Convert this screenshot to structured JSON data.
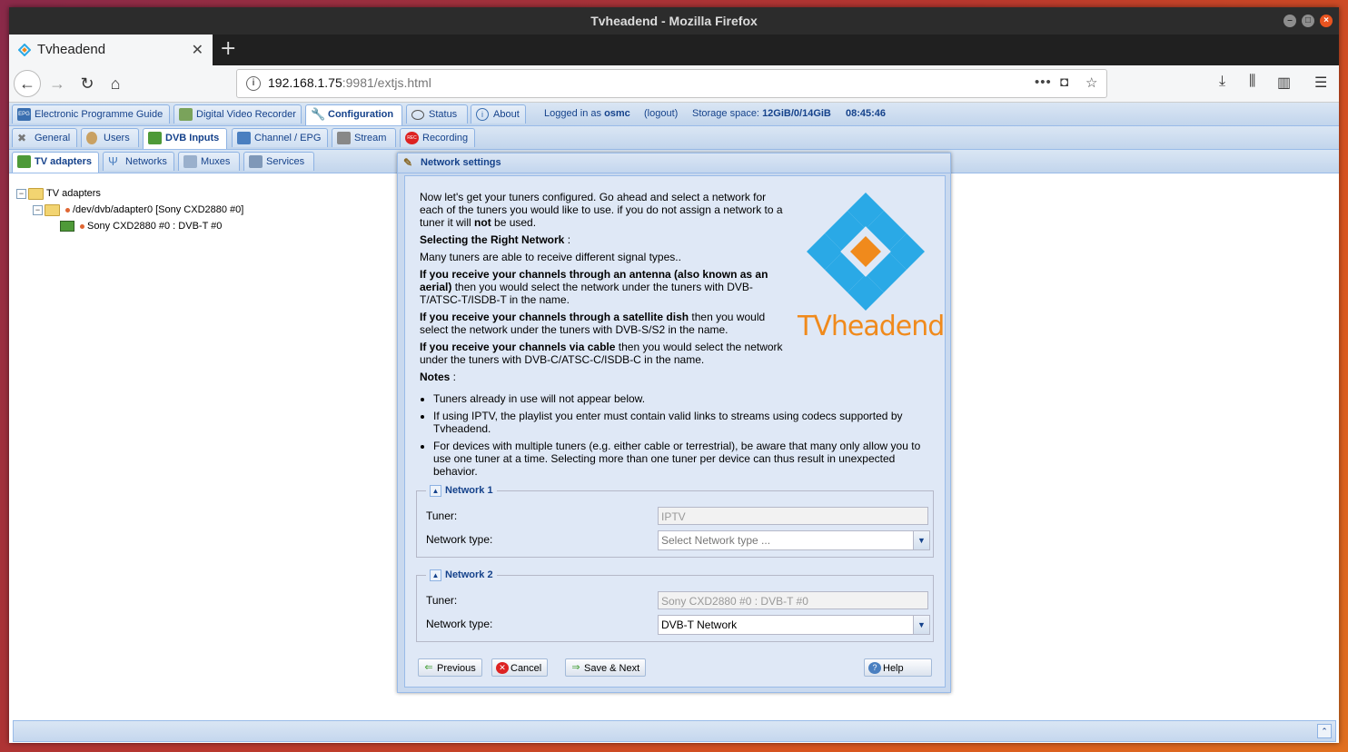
{
  "window": {
    "title": "Tvheadend - Mozilla Firefox"
  },
  "browser": {
    "tab_title": "Tvheadend",
    "url_host": "192.168.1.75",
    "url_rest": ":9981/extjs.html",
    "overflow": "•••"
  },
  "toolbar1": {
    "tabs": [
      "Electronic Programme Guide",
      "Digital Video Recorder",
      "Configuration",
      "Status",
      "About"
    ],
    "logged_in_prefix": "Logged in as",
    "user": "osmc",
    "logout": "(logout)",
    "storage_label": "Storage space:",
    "storage_value": "12GiB/0/14GiB",
    "time": "08:45:46"
  },
  "toolbar2": {
    "tabs": [
      "General",
      "Users",
      "DVB Inputs",
      "Channel / EPG",
      "Stream",
      "Recording"
    ]
  },
  "toolbar3": {
    "tabs": [
      "TV adapters",
      "Networks",
      "Muxes",
      "Services"
    ]
  },
  "tree": {
    "root": "TV adapters",
    "adapter": "/dev/dvb/adapter0 [Sony CXD2880 #0]",
    "frontend": "Sony CXD2880 #0 : DVB-T #0"
  },
  "dialog": {
    "title": "Network settings",
    "intro": "Now let's get your tuners configured. Go ahead and select a network for each of the tuners you would like to use. if you do not assign a network to a tuner it will",
    "intro_bold": "not",
    "intro_end": "be used.",
    "h_select": "Selecting the Right Network",
    "h_select_tail": " :",
    "many": "Many tuners are able to receive different signal types..",
    "antenna_bold": "If you receive your channels through an antenna (also known as an aerial)",
    "antenna_rest": " then you would select the network under the tuners with DVB-T/ATSC-T/ISDB-T in the name.",
    "dish_bold": "If you receive your channels through a satellite dish",
    "dish_rest": " then you would select the network under the tuners with DVB-S/S2 in the name.",
    "cable_bold": "If you receive your channels via cable",
    "cable_rest": " then you would select the network under the tuners with DVB-C/ATSC-C/ISDB-C in the name.",
    "notes_h": "Notes",
    "notes_tail": " :",
    "notes": [
      "Tuners already in use will not appear below.",
      "If using IPTV, the playlist you enter must contain valid links to streams using codecs supported by Tvheadend.",
      "For devices with multiple tuners (e.g. either cable or terrestrial), be aware that many only allow you to use one tuner at a time. Selecting more than one tuner per device can thus result in unexpected behavior."
    ],
    "logo_text": "TVheadend",
    "network1": {
      "legend": "Network 1",
      "tuner_label": "Tuner:",
      "tuner_value": "IPTV",
      "type_label": "Network type:",
      "type_placeholder": "Select Network type ..."
    },
    "network2": {
      "legend": "Network 2",
      "tuner_label": "Tuner:",
      "tuner_value": "Sony CXD2880 #0 : DVB-T #0",
      "type_label": "Network type:",
      "type_value": "DVB-T Network"
    },
    "buttons": {
      "previous": "Previous",
      "cancel": "Cancel",
      "save_next": "Save & Next",
      "help": "Help"
    }
  },
  "colors": {
    "ext_blue": "#15428b",
    "logo_blue": "#2aa9e6",
    "logo_orange": "#f08a1c"
  }
}
